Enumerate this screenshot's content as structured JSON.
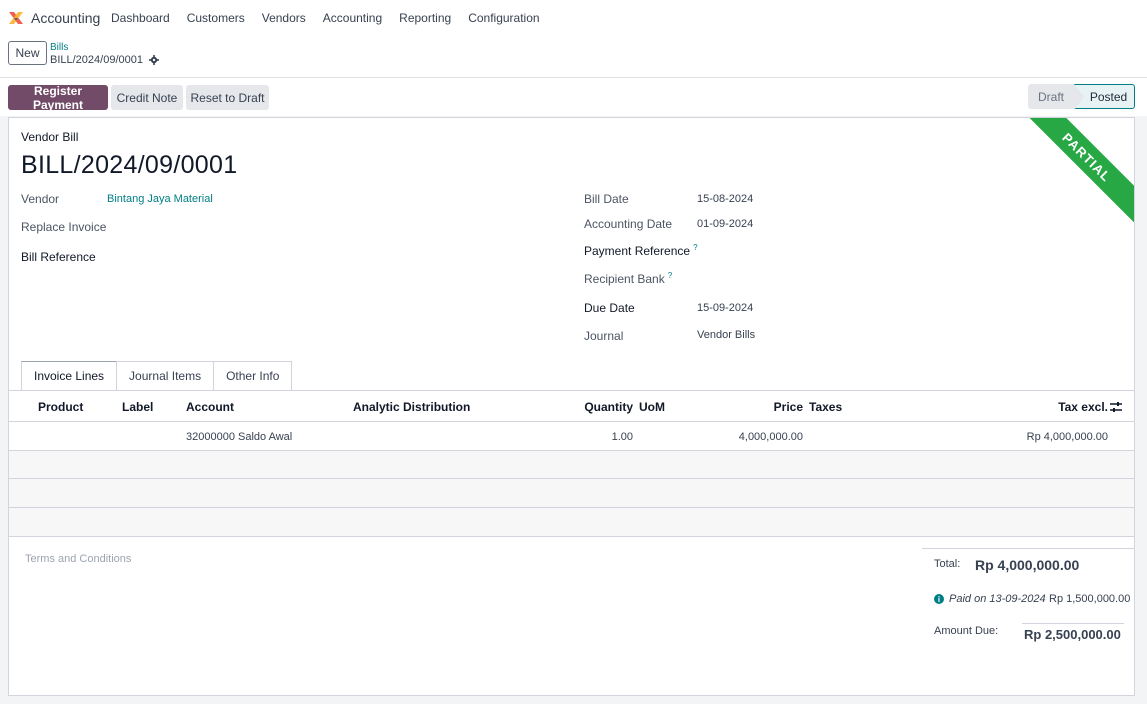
{
  "topnav": {
    "app_name": "Accounting",
    "menu": [
      "Dashboard",
      "Customers",
      "Vendors",
      "Accounting",
      "Reporting",
      "Configuration"
    ]
  },
  "control": {
    "new_label": "New",
    "breadcrumb_parent": "Bills",
    "breadcrumb_current": "BILL/2024/09/0001"
  },
  "buttons": {
    "register_payment": "Register Payment",
    "credit_note": "Credit Note",
    "reset_to_draft": "Reset to Draft"
  },
  "status": {
    "draft": "Draft",
    "posted": "Posted",
    "active": "Posted",
    "ribbon": "PARTIAL"
  },
  "doc": {
    "type": "Vendor Bill",
    "number": "BILL/2024/09/0001"
  },
  "fields": {
    "vendor_label": "Vendor",
    "vendor_value": "Bintang Jaya Material",
    "replace_invoice_label": "Replace Invoice",
    "bill_reference_label": "Bill Reference",
    "bill_date_label": "Bill Date",
    "bill_date_value": "15-08-2024",
    "accounting_date_label": "Accounting Date",
    "accounting_date_value": "01-09-2024",
    "payment_reference_label": "Payment Reference",
    "recipient_bank_label": "Recipient Bank",
    "due_date_label": "Due Date",
    "due_date_value": "15-09-2024",
    "journal_label": "Journal",
    "journal_value": "Vendor Bills",
    "help_mark": "?"
  },
  "tabs": [
    "Invoice Lines",
    "Journal Items",
    "Other Info"
  ],
  "table": {
    "headers": {
      "product": "Product",
      "label": "Label",
      "account": "Account",
      "analytic": "Analytic Distribution",
      "quantity": "Quantity",
      "uom": "UoM",
      "price": "Price",
      "taxes": "Taxes",
      "tax_excl": "Tax excl."
    },
    "rows": [
      {
        "product": "",
        "label": "",
        "account": "32000000 Saldo Awal",
        "analytic": "",
        "quantity": "1.00",
        "uom": "",
        "price": "4,000,000.00",
        "taxes": "",
        "tax_excl": "Rp 4,000,000.00"
      }
    ]
  },
  "terms_placeholder": "Terms and Conditions",
  "totals": {
    "total_label": "Total:",
    "total_value": "Rp 4,000,000.00",
    "paid_text": "Paid on 13-09-2024",
    "paid_amount": "Rp 1,500,000.00",
    "amount_due_label": "Amount Due:",
    "amount_due_value": "Rp 2,500,000.00"
  },
  "colors": {
    "primary": "#714b67",
    "link": "#017e84",
    "ribbon": "#28a745"
  }
}
